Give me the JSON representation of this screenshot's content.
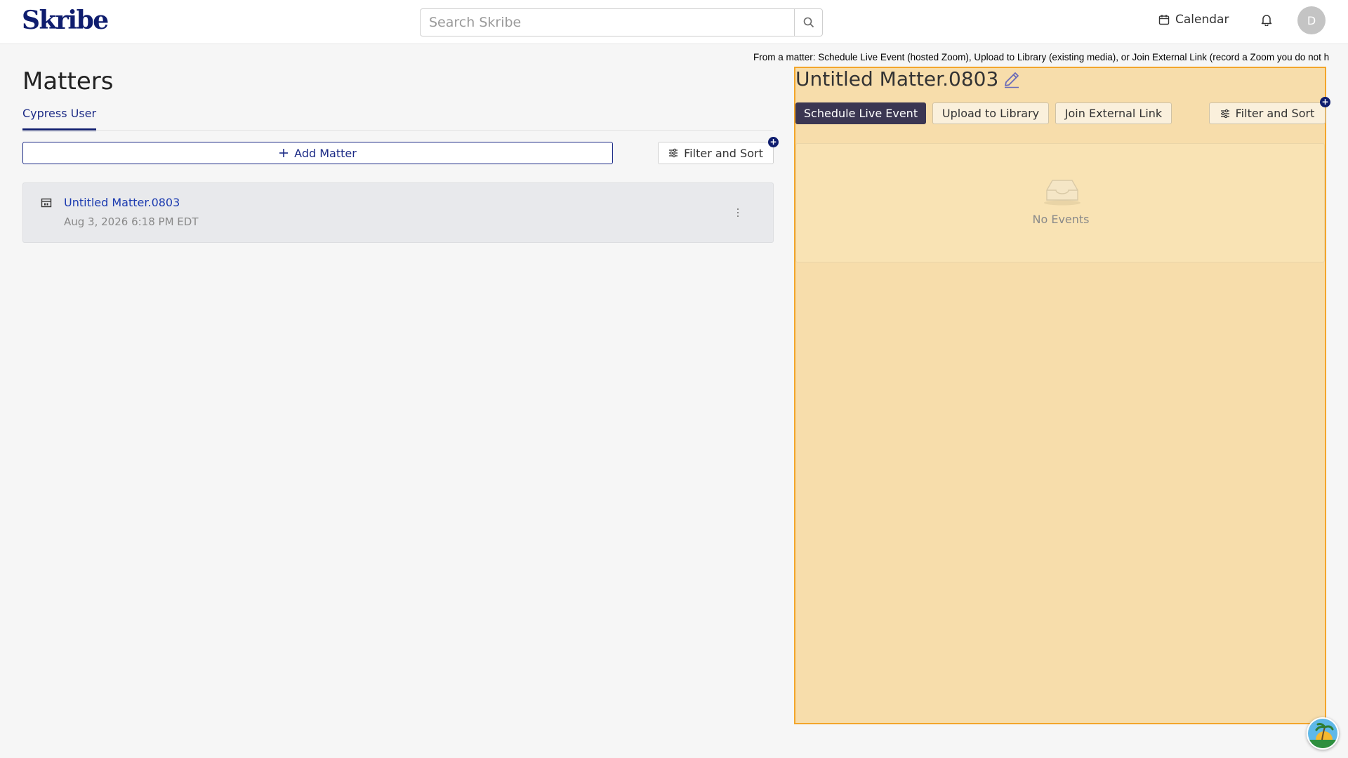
{
  "header": {
    "logo": "Skribe",
    "search": {
      "placeholder": "Search Skribe",
      "value": ""
    },
    "calendar_label": "Calendar",
    "avatar_initial": "D"
  },
  "banner_text": "From a matter: Schedule Live Event (hosted Zoom), Upload to Library (existing media), or Join External Link (record a Zoom you do not h",
  "matters": {
    "title": "Matters",
    "tabs": [
      {
        "label": "Cypress User",
        "active": true
      }
    ],
    "add_button_label": "Add Matter",
    "filter_label": "Filter and Sort",
    "items": [
      {
        "name": "Untitled Matter.0803",
        "date": "Aug 3, 2026 6:18 PM EDT"
      }
    ]
  },
  "matter_detail": {
    "title": "Untitled Matter.0803",
    "actions": {
      "schedule": "Schedule Live Event",
      "upload": "Upload to Library",
      "join": "Join External Link",
      "filter": "Filter and Sort"
    },
    "empty_text": "No Events"
  },
  "colors": {
    "brand_navy": "#0f1d6e",
    "link_blue": "#1c3bb0",
    "highlight_fill": "#f7ddab",
    "highlight_border": "#f3a52a",
    "primary_button": "#3b3652"
  },
  "icons": {
    "search": "search-icon",
    "calendar": "calendar-icon",
    "notifications": "bell-icon",
    "add": "plus-icon",
    "filter": "sliders-icon",
    "matter": "matter-icon",
    "more": "kebab-icon",
    "edit": "pencil-icon",
    "empty": "inbox-icon"
  }
}
